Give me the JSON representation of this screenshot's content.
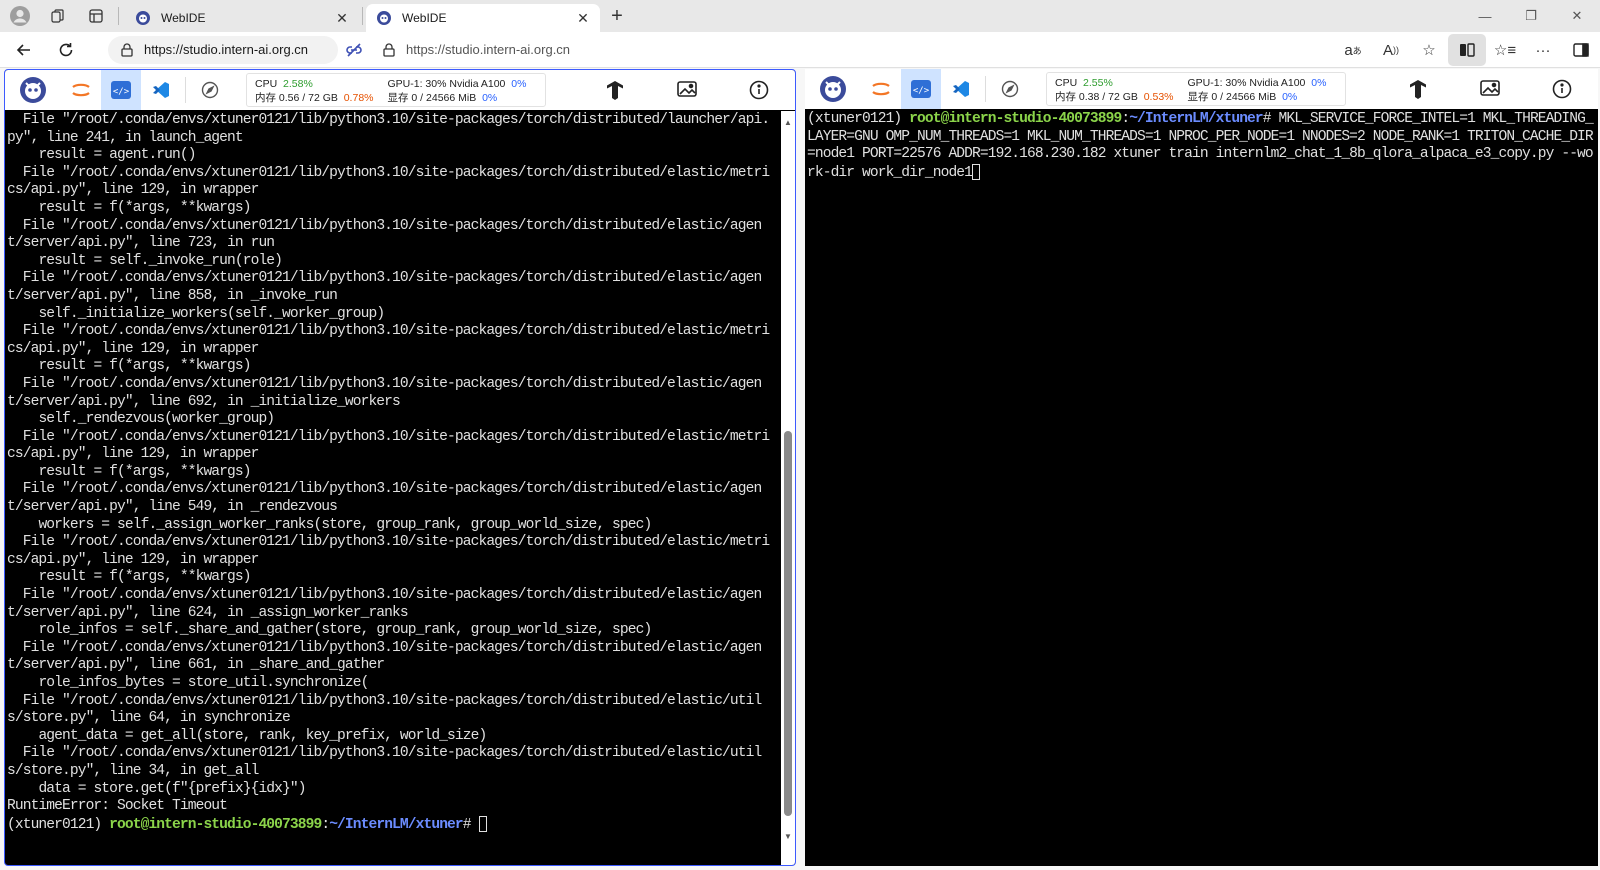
{
  "browser": {
    "tabs": [
      {
        "title": "WebIDE",
        "active": false
      },
      {
        "title": "WebIDE",
        "active": true
      }
    ],
    "new_tab_label": "+",
    "url_left": "https://studio.intern-ai.org.cn",
    "url_right": "https://studio.intern-ai.org.cn",
    "icons": {
      "profile": "profile-icon",
      "workspaces": "workspaces-icon",
      "tab_actions": "tab-actions-icon",
      "read_aloud": "read-aloud-icon",
      "translate": "translate-icon",
      "favorite": "star-icon",
      "split": "split-screen-icon",
      "collections": "collections-icon",
      "more": "more-icon",
      "sidebar": "sidebar-icon"
    },
    "accent_color": "#3d5afe"
  },
  "left_pane": {
    "monitor": {
      "cpu_label": "CPU",
      "cpu_value": "2.58%",
      "mem_label": "内存 0.56 / 72 GB",
      "mem_value": "0.78%",
      "gpu_label": "GPU-1: 30% Nvidia A100",
      "gpu_value": "0%",
      "vram_label": "显存 0 / 24566 MiB",
      "vram_value": "0%"
    },
    "terminal_lines": [
      "  File \"/root/.conda/envs/xtuner0121/lib/python3.10/site-packages/torch/distributed/launcher/api.py\", line 241, in launch_agent",
      "    result = agent.run()",
      "  File \"/root/.conda/envs/xtuner0121/lib/python3.10/site-packages/torch/distributed/elastic/metrics/api.py\", line 129, in wrapper",
      "    result = f(*args, **kwargs)",
      "  File \"/root/.conda/envs/xtuner0121/lib/python3.10/site-packages/torch/distributed/elastic/agent/server/api.py\", line 723, in run",
      "    result = self._invoke_run(role)",
      "  File \"/root/.conda/envs/xtuner0121/lib/python3.10/site-packages/torch/distributed/elastic/agent/server/api.py\", line 858, in _invoke_run",
      "    self._initialize_workers(self._worker_group)",
      "  File \"/root/.conda/envs/xtuner0121/lib/python3.10/site-packages/torch/distributed/elastic/metrics/api.py\", line 129, in wrapper",
      "    result = f(*args, **kwargs)",
      "  File \"/root/.conda/envs/xtuner0121/lib/python3.10/site-packages/torch/distributed/elastic/agent/server/api.py\", line 692, in _initialize_workers",
      "    self._rendezvous(worker_group)",
      "  File \"/root/.conda/envs/xtuner0121/lib/python3.10/site-packages/torch/distributed/elastic/metrics/api.py\", line 129, in wrapper",
      "    result = f(*args, **kwargs)",
      "  File \"/root/.conda/envs/xtuner0121/lib/python3.10/site-packages/torch/distributed/elastic/agent/server/api.py\", line 549, in _rendezvous",
      "    workers = self._assign_worker_ranks(store, group_rank, group_world_size, spec)",
      "  File \"/root/.conda/envs/xtuner0121/lib/python3.10/site-packages/torch/distributed/elastic/metrics/api.py\", line 129, in wrapper",
      "    result = f(*args, **kwargs)",
      "  File \"/root/.conda/envs/xtuner0121/lib/python3.10/site-packages/torch/distributed/elastic/agent/server/api.py\", line 624, in _assign_worker_ranks",
      "    role_infos = self._share_and_gather(store, group_rank, group_world_size, spec)",
      "  File \"/root/.conda/envs/xtuner0121/lib/python3.10/site-packages/torch/distributed/elastic/agent/server/api.py\", line 661, in _share_and_gather",
      "    role_infos_bytes = store_util.synchronize(",
      "  File \"/root/.conda/envs/xtuner0121/lib/python3.10/site-packages/torch/distributed/elastic/utils/store.py\", line 64, in synchronize",
      "    agent_data = get_all(store, rank, key_prefix, world_size)",
      "  File \"/root/.conda/envs/xtuner0121/lib/python3.10/site-packages/torch/distributed/elastic/utils/store.py\", line 34, in get_all",
      "    data = store.get(f\"{prefix}{idx}\")",
      "RuntimeError: Socket Timeout"
    ],
    "prompt": {
      "env": "(xtuner0121) ",
      "user_host": "root@intern-studio-40073899",
      "sep": ":",
      "path": "~/InternLM/xtuner",
      "suffix": "# "
    }
  },
  "right_pane": {
    "monitor": {
      "cpu_label": "CPU",
      "cpu_value": "2.55%",
      "mem_label": "内存 0.38 / 72 GB",
      "mem_value": "0.53%",
      "gpu_label": "GPU-1: 30% Nvidia A100",
      "gpu_value": "0%",
      "vram_label": "显存 0 / 24566 MiB",
      "vram_value": "0%"
    },
    "prompt": {
      "env": "(xtuner0121) ",
      "user_host": "root@intern-studio-40073899",
      "sep": ":",
      "path": "~/InternLM/xtuner",
      "suffix": "# "
    },
    "command": "MKL_SERVICE_FORCE_INTEL=1 MKL_THREADING_LAYER=GNU OMP_NUM_THREADS=1 MKL_NUM_THREADS=1 NPROC_PER_NODE=1 NNODES=2 NODE_RANK=1 TRITON_CACHE_DIR=node1 PORT=22576 ADDR=192.168.230.182 xtuner train internlm2_chat_1_8b_qlora_alpaca_e3_copy.py --work-dir work_dir_node1"
  }
}
